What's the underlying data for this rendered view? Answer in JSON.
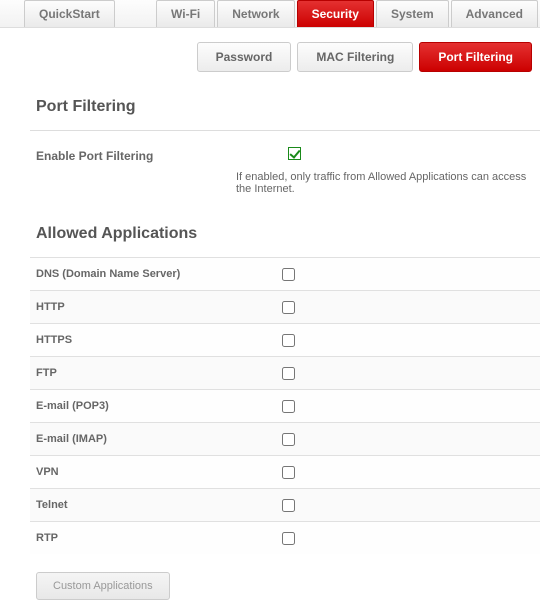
{
  "mainTabs": {
    "quickstart": "QuickStart",
    "wifi": "Wi-Fi",
    "network": "Network",
    "security": "Security",
    "system": "System",
    "advanced": "Advanced"
  },
  "subTabs": {
    "password": "Password",
    "macFiltering": "MAC Filtering",
    "portFiltering": "Port Filtering"
  },
  "section1": {
    "title": "Port Filtering",
    "enableLabel": "Enable Port Filtering",
    "enableChecked": true,
    "enableDesc": "If enabled, only traffic from Allowed Applications can access the Internet."
  },
  "section2": {
    "title": "Allowed Applications",
    "apps": [
      {
        "name": "DNS (Domain Name Server)",
        "checked": false
      },
      {
        "name": "HTTP",
        "checked": false
      },
      {
        "name": "HTTPS",
        "checked": false
      },
      {
        "name": "FTP",
        "checked": false
      },
      {
        "name": "E-mail (POP3)",
        "checked": false
      },
      {
        "name": "E-mail (IMAP)",
        "checked": false
      },
      {
        "name": "VPN",
        "checked": false
      },
      {
        "name": "Telnet",
        "checked": false
      },
      {
        "name": "RTP",
        "checked": false
      }
    ],
    "customButton": "Custom Applications"
  }
}
